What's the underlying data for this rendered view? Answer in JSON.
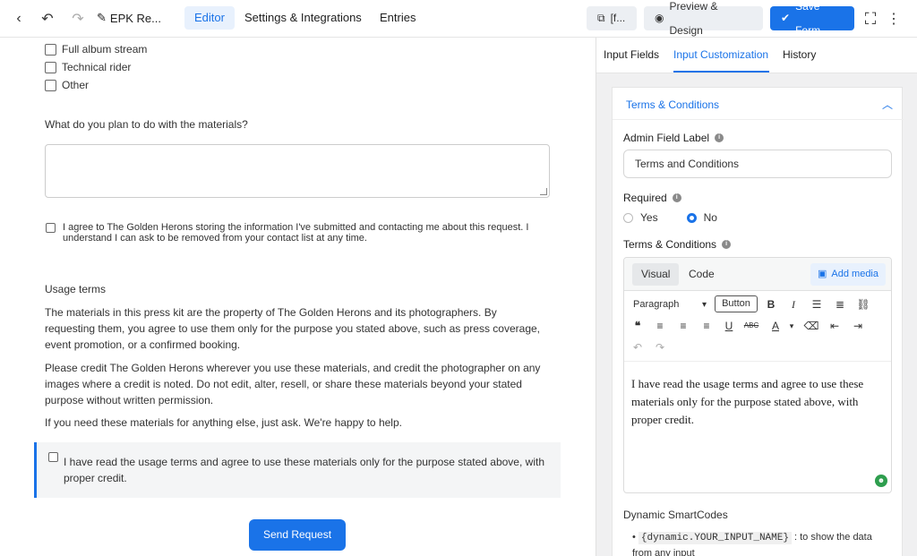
{
  "topbar": {
    "form_title": "EPK Re...",
    "tabs": [
      "Editor",
      "Settings & Integrations",
      "Entries"
    ],
    "shortcode_label": "[f...",
    "preview_label": "Preview & Design",
    "save_label": "Save Form"
  },
  "form": {
    "checkboxes": [
      "Full album stream",
      "Technical rider",
      "Other"
    ],
    "plan_question": "What do you plan to do with the materials?",
    "consent_text": "I agree to The Golden Herons storing the information I've submitted and contacting me about this request. I understand I can ask to be removed from your contact list at any time.",
    "usage_heading": "Usage terms",
    "para1": "The materials in this press kit are the property of The Golden Herons and its photographers. By requesting them, you agree to use them only for the purpose you stated above, such as press coverage, event promotion, or a confirmed booking.",
    "para2": "Please credit The Golden Herons wherever you use these materials, and credit the photographer on any images where a credit is noted. Do not edit, alter, resell, or share these materials beyond your stated purpose without written permission.",
    "para3": "If you need these materials for anything else, just ask. We're happy to help.",
    "terms_text": "I have read the usage terms and agree to use these materials only for the purpose stated above, with proper credit.",
    "submit_label": "Send Request"
  },
  "panel": {
    "tabs": [
      "Input Fields",
      "Input Customization",
      "History"
    ],
    "section_title": "Terms & Conditions",
    "admin_label_title": "Admin Field Label",
    "admin_label_value": "Terms and Conditions",
    "required_title": "Required",
    "required_options": [
      "Yes",
      "No"
    ],
    "required_selected": "No",
    "terms_title": "Terms & Conditions",
    "editor_tabs": [
      "Visual",
      "Code"
    ],
    "add_media_label": "Add media",
    "format_select": "Paragraph",
    "button_label": "Button",
    "editor_content": "I have read the usage terms and agree to use these materials only for the purpose stated above, with proper credit.",
    "smartcodes_title": "Dynamic SmartCodes",
    "smartcode": "{dynamic.YOUR_INPUT_NAME}",
    "smartcode_desc": ": to show the data from any input"
  },
  "colors": {
    "accent": "#1a73e8",
    "panel_bg": "#f0f0f1"
  }
}
